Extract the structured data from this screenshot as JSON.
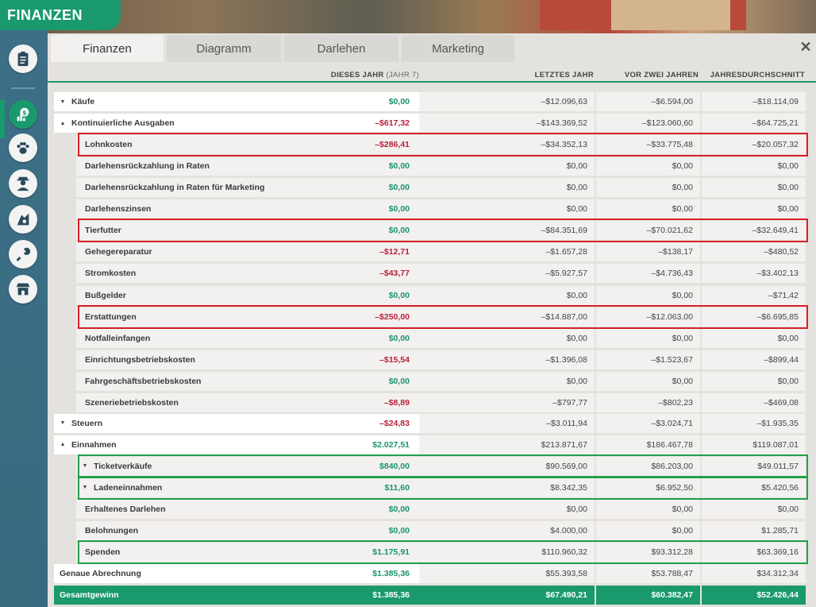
{
  "window": {
    "title": "FINANZEN"
  },
  "tabs": [
    {
      "label": "Finanzen",
      "active": true
    },
    {
      "label": "Diagramm",
      "active": false
    },
    {
      "label": "Darlehen",
      "active": false
    },
    {
      "label": "Marketing",
      "active": false
    }
  ],
  "columns": {
    "this_year": "DIESES JAHR",
    "this_year_sub": "(JAHR 7)",
    "last_year": "LETZTES JAHR",
    "two_years": "VOR ZWEI JAHREN",
    "average": "JAHRESDURCHSCHNITT"
  },
  "sidebar": [
    {
      "icon": "clipboard-icon"
    },
    {
      "icon": "money-icon",
      "active": true
    },
    {
      "icon": "paw-icon"
    },
    {
      "icon": "keeper-icon"
    },
    {
      "icon": "animal-care-icon"
    },
    {
      "icon": "wrench-icon"
    },
    {
      "icon": "shop-icon"
    }
  ],
  "rows": [
    {
      "label": "Käufe",
      "level": 0,
      "caret": "▼",
      "current": "$0,00",
      "sign": "pos",
      "last": "–$12.096,63",
      "two": "–$6.594,00",
      "avg": "–$18.114,09"
    },
    {
      "label": "Kontinuierliche Ausgaben",
      "level": 0,
      "caret": "▲",
      "current": "–$617,32",
      "sign": "neg",
      "last": "–$143.369,52",
      "two": "–$123.060,60",
      "avg": "–$64.725,21"
    },
    {
      "label": "Lohnkosten",
      "level": 1,
      "current": "–$286,41",
      "sign": "neg",
      "last": "–$34.352,13",
      "two": "–$33.775,48",
      "avg": "–$20.057,32",
      "highlight": "red"
    },
    {
      "label": "Darlehensrückzahlung in Raten",
      "level": 1,
      "current": "$0,00",
      "sign": "pos",
      "last": "$0,00",
      "two": "$0,00",
      "avg": "$0,00"
    },
    {
      "label": "Darlehensrückzahlung in Raten für Marketing",
      "level": 1,
      "current": "$0,00",
      "sign": "pos",
      "last": "$0,00",
      "two": "$0,00",
      "avg": "$0,00"
    },
    {
      "label": "Darlehenszinsen",
      "level": 1,
      "current": "$0,00",
      "sign": "pos",
      "last": "$0,00",
      "two": "$0,00",
      "avg": "$0,00"
    },
    {
      "label": "Tierfutter",
      "level": 1,
      "current": "$0,00",
      "sign": "pos",
      "last": "–$84.351,69",
      "two": "–$70.021,62",
      "avg": "–$32.649,41",
      "highlight": "red"
    },
    {
      "label": "Gehegereparatur",
      "level": 1,
      "current": "–$12,71",
      "sign": "neg",
      "last": "–$1.657,28",
      "two": "–$138,17",
      "avg": "–$480,52"
    },
    {
      "label": "Stromkosten",
      "level": 1,
      "current": "–$43,77",
      "sign": "neg",
      "last": "–$5.927,57",
      "two": "–$4.736,43",
      "avg": "–$3.402,13"
    },
    {
      "label": "Bußgelder",
      "level": 1,
      "current": "$0,00",
      "sign": "pos",
      "last": "$0,00",
      "two": "$0,00",
      "avg": "–$71,42"
    },
    {
      "label": "Erstattungen",
      "level": 1,
      "current": "–$250,00",
      "sign": "neg",
      "last": "–$14.887,00",
      "two": "–$12.063,00",
      "avg": "–$6.695,85",
      "highlight": "red"
    },
    {
      "label": "Notfalleinfangen",
      "level": 1,
      "current": "$0,00",
      "sign": "pos",
      "last": "$0,00",
      "two": "$0,00",
      "avg": "$0,00"
    },
    {
      "label": "Einrichtungsbetriebskosten",
      "level": 1,
      "current": "–$15,54",
      "sign": "neg",
      "last": "–$1.396,08",
      "two": "–$1.523,67",
      "avg": "–$899,44"
    },
    {
      "label": "Fahrgeschäftsbetriebskosten",
      "level": 1,
      "current": "$0,00",
      "sign": "pos",
      "last": "$0,00",
      "two": "$0,00",
      "avg": "$0,00"
    },
    {
      "label": "Szeneriebetriebskosten",
      "level": 1,
      "current": "–$8,89",
      "sign": "neg",
      "last": "–$797,77",
      "two": "–$802,23",
      "avg": "–$469,08"
    },
    {
      "label": "Steuern",
      "level": 0,
      "caret": "▼",
      "current": "–$24,83",
      "sign": "neg",
      "last": "–$3.011,94",
      "two": "–$3.024,71",
      "avg": "–$1.935,35"
    },
    {
      "label": "Einnahmen",
      "level": 0,
      "caret": "▲",
      "current": "$2.027,51",
      "sign": "pos",
      "last": "$213.871,67",
      "two": "$186.467,78",
      "avg": "$119.087,01"
    },
    {
      "label": "Ticketverkäufe",
      "level": 1,
      "caret": "▼",
      "current": "$840,00",
      "sign": "pos",
      "last": "$90.569,00",
      "two": "$86.203,00",
      "avg": "$49.011,57",
      "highlight": "green"
    },
    {
      "label": "Ladeneinnahmen",
      "level": 1,
      "caret": "▼",
      "current": "$11,60",
      "sign": "pos",
      "last": "$8.342,35",
      "two": "$6.952,50",
      "avg": "$5.420,56",
      "highlight": "green"
    },
    {
      "label": "Erhaltenes Darlehen",
      "level": 1,
      "current": "$0,00",
      "sign": "pos",
      "last": "$0,00",
      "two": "$0,00",
      "avg": "$0,00"
    },
    {
      "label": "Belohnungen",
      "level": 1,
      "current": "$0,00",
      "sign": "pos",
      "last": "$4.000,00",
      "two": "$0,00",
      "avg": "$1.285,71"
    },
    {
      "label": "Spenden",
      "level": 1,
      "current": "$1.175,91",
      "sign": "pos",
      "last": "$110.960,32",
      "two": "$93.312,28",
      "avg": "$63.369,16",
      "highlight": "green"
    },
    {
      "label": "Genaue Abrechnung",
      "level": -1,
      "current": "$1.385,36",
      "sign": "pos",
      "last": "$55.393,58",
      "two": "$53.788,47",
      "avg": "$34.312,34"
    },
    {
      "label": "Gesamtgewinn",
      "level": -1,
      "total": true,
      "current": "$1.385,36",
      "sign": "pos",
      "last": "$67.490,21",
      "two": "$60.382,47",
      "avg": "$52.426,44"
    }
  ]
}
